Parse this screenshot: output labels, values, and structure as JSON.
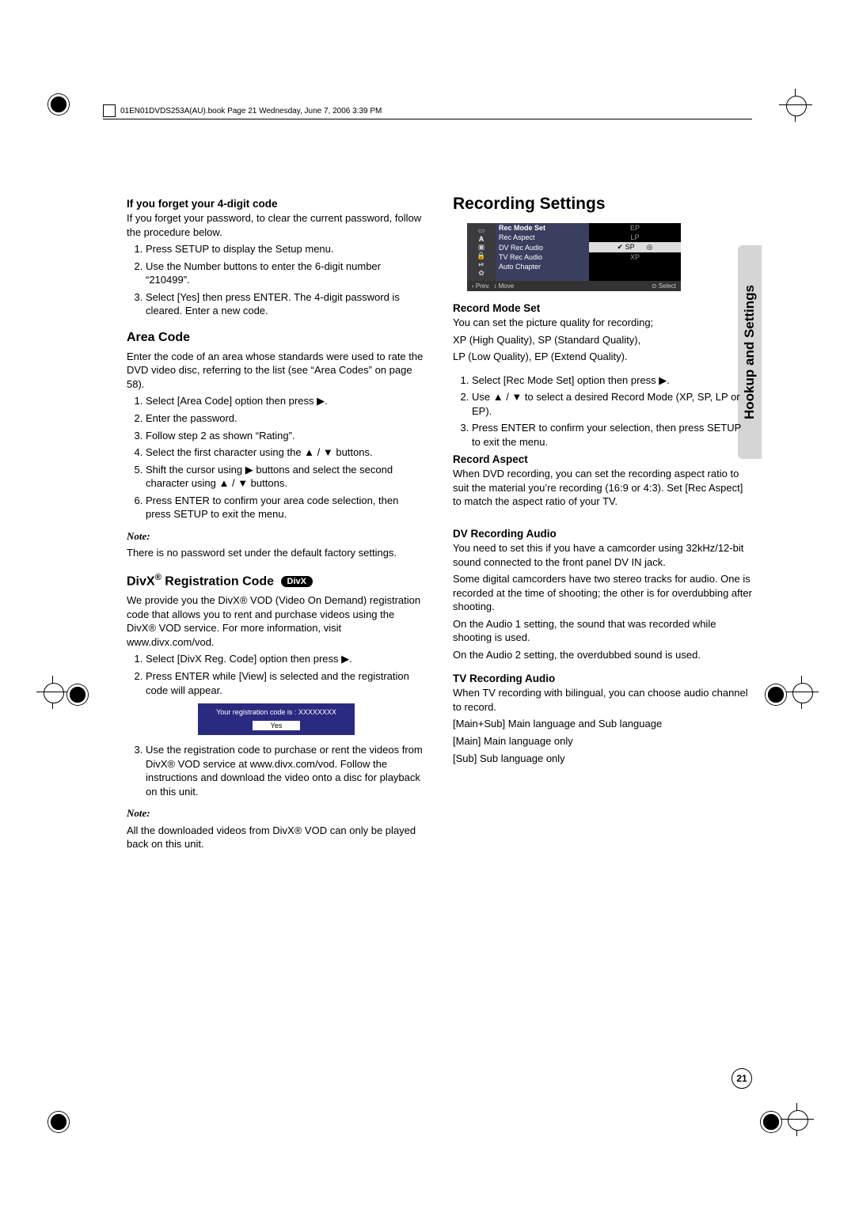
{
  "header": "01EN01DVDS253A(AU).book  Page 21  Wednesday, June 7, 2006  3:39 PM",
  "side_tab": "Hookup and Settings",
  "page_number": "21",
  "left": {
    "forgot_title": "If you forget your 4-digit code",
    "forgot_intro": "If you forget your password, to clear the current password, follow the procedure below.",
    "forgot_steps": [
      "Press SETUP to display the Setup menu.",
      "Use the Number buttons to enter the 6-digit number “210499”.",
      "Select [Yes] then press ENTER. The 4-digit password is cleared. Enter a new code."
    ],
    "area_title": "Area Code",
    "area_intro": "Enter the code of an area whose standards were used to rate the DVD video disc, referring to the list (see “Area Codes” on page 58).",
    "area_steps": [
      "Select [Area Code] option then press ▶.",
      "Enter the password.",
      "Follow step 2 as shown “Rating”.",
      "Select the first character using the ▲ / ▼ buttons.",
      "Shift the cursor using ▶ buttons and select the second character using ▲ / ▼ buttons.",
      "Press ENTER to confirm your area code selection, then press SETUP to exit the menu."
    ],
    "note1_head": "Note:",
    "note1_body": "There is no password set under the default factory settings.",
    "divx_title_pre": "DivX",
    "divx_title_post": " Registration Code",
    "divx_badge": "DivX",
    "divx_intro": "We provide you the DivX® VOD (Video On Demand) registration code that allows you to rent and purchase videos using the DivX® VOD service. For more information, visit www.divx.com/vod.",
    "divx_steps_a": [
      "Select [DivX Reg. Code] option then press ▶.",
      "Press ENTER while [View] is selected and the registration code will appear."
    ],
    "reg_box_line": "Your registration code is : XXXXXXXX",
    "reg_box_yes": "Yes",
    "divx_step3": "Use the registration code to purchase or rent the videos from DivX® VOD service at www.divx.com/vod. Follow the instructions and download the video onto a disc for playback on this unit.",
    "note2_head": "Note:",
    "note2_body": "All the downloaded videos from DivX® VOD can only be played back on this unit."
  },
  "right": {
    "title": "Recording Settings",
    "menu": {
      "items": [
        "Rec Mode Set",
        "Rec Aspect",
        "DV Rec Audio",
        "TV Rec Audio",
        "Auto Chapter"
      ],
      "values": [
        "EP",
        "LP",
        "SP",
        "XP"
      ],
      "selected_index": 2,
      "foot_prev": "‹ Prev.",
      "foot_move": "↕ Move",
      "foot_select": "⊙ Select"
    },
    "rms_title": "Record Mode Set",
    "rms_intro1": "You can set the picture quality for recording;",
    "rms_intro2": "XP (High Quality), SP (Standard Quality),",
    "rms_intro3": "LP (Low Quality), EP (Extend Quality).",
    "rms_steps": [
      "Select [Rec Mode Set] option then press ▶.",
      "Use ▲ / ▼ to select a desired Record Mode (XP, SP, LP or EP).",
      "Press ENTER to confirm your selection, then press SETUP to exit the menu."
    ],
    "ra_title": "Record Aspect",
    "ra_body": "When DVD recording, you can set the recording aspect ratio to suit the material you’re recording (16:9 or 4:3). Set [Rec Aspect] to match the aspect ratio of your TV.",
    "dv_title": "DV Recording Audio",
    "dv_p1": "You need to set this if you have a camcorder using 32kHz/12-bit sound connected to the front panel DV IN jack.",
    "dv_p2": "Some digital camcorders have two stereo tracks for audio. One is recorded at the time of shooting; the other is for overdubbing after shooting.",
    "dv_p3": "On the Audio 1 setting, the sound that was recorded while shooting is used.",
    "dv_p4": "On the Audio 2 setting, the overdubbed sound is used.",
    "tv_title": "TV Recording Audio",
    "tv_p1": "When TV recording with bilingual, you can choose audio channel to record.",
    "tv_p2": "[Main+Sub] Main language and Sub language",
    "tv_p3": "[Main] Main language only",
    "tv_p4": "[Sub] Sub language only"
  }
}
